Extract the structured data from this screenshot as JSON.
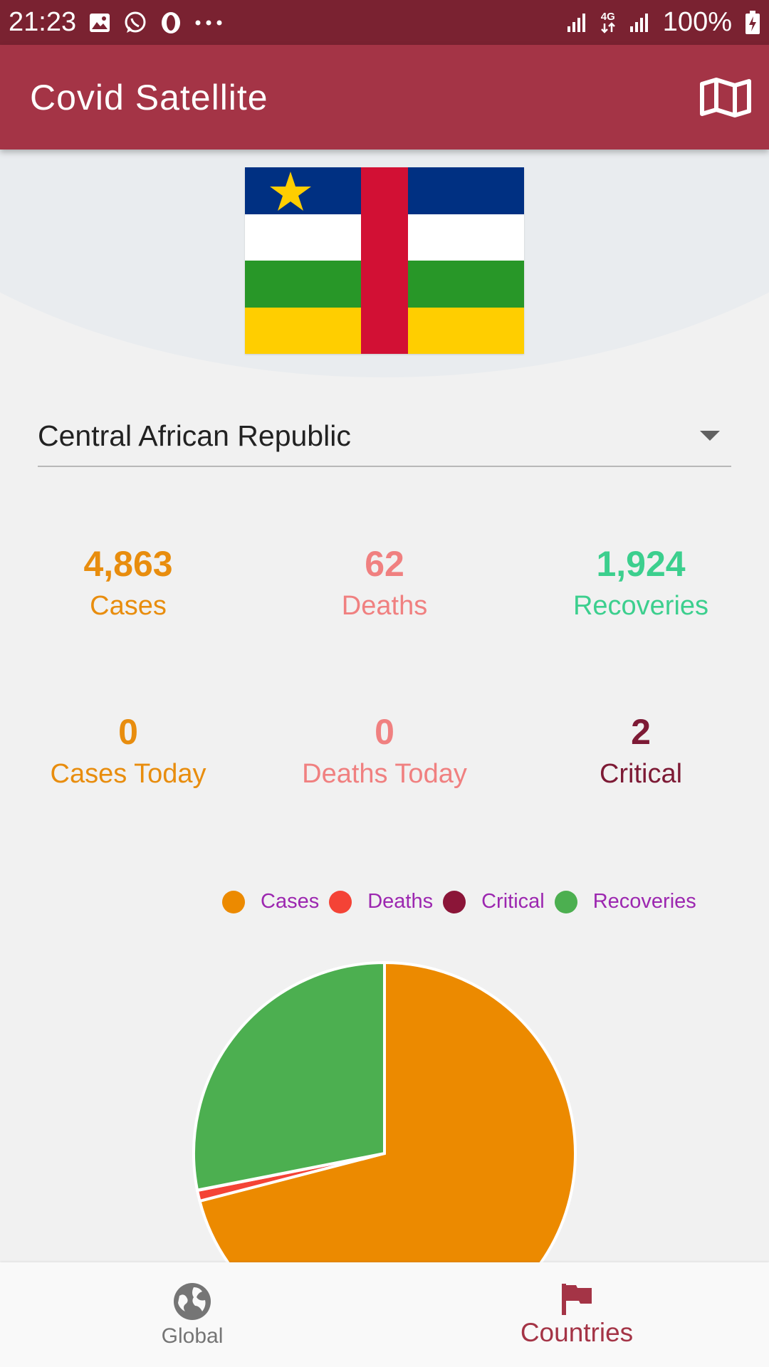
{
  "status_bar": {
    "time": "21:23",
    "battery": "100%",
    "network": "4G",
    "left_icons": [
      "image-icon",
      "whatsapp-icon",
      "opera-icon",
      "more-dots-icon"
    ],
    "right_icons": [
      "signal-icon",
      "network-4g-icon",
      "signal-icon",
      "battery-charging-icon"
    ]
  },
  "app_bar": {
    "title": "Covid Satellite",
    "action_icon": "map-icon"
  },
  "country": {
    "selected": "Central African Republic",
    "flag": {
      "stripes": [
        "#003082",
        "#ffffff",
        "#289728",
        "#ffce00"
      ],
      "band": "#d21034",
      "star": "#ffce00"
    }
  },
  "stats": {
    "cases": {
      "value": "4,863",
      "label": "Cases"
    },
    "deaths": {
      "value": "62",
      "label": "Deaths"
    },
    "recoveries": {
      "value": "1,924",
      "label": "Recoveries"
    },
    "cases_today": {
      "value": "0",
      "label": "Cases Today"
    },
    "deaths_today": {
      "value": "0",
      "label": "Deaths Today"
    },
    "critical": {
      "value": "2",
      "label": "Critical"
    }
  },
  "legend": [
    {
      "label": "Cases",
      "color": "#ec8a00"
    },
    {
      "label": "Deaths",
      "color": "#f44336"
    },
    {
      "label": "Critical",
      "color": "#8b1538"
    },
    {
      "label": "Recoveries",
      "color": "#4caf50"
    }
  ],
  "chart_data": {
    "type": "pie",
    "categories": [
      "Cases",
      "Deaths",
      "Critical",
      "Recoveries"
    ],
    "values": [
      4863,
      62,
      2,
      1924
    ],
    "colors": [
      "#ec8a00",
      "#f44336",
      "#8b1538",
      "#4caf50"
    ],
    "legend": "top"
  },
  "bottom_nav": {
    "global": {
      "label": "Global",
      "icon": "globe-icon"
    },
    "countries": {
      "label": "Countries",
      "icon": "flag-icon",
      "active": true
    }
  },
  "colors": {
    "status_bar": "#7a2231",
    "app_bar": "#a43446",
    "accent": "#a43446"
  }
}
